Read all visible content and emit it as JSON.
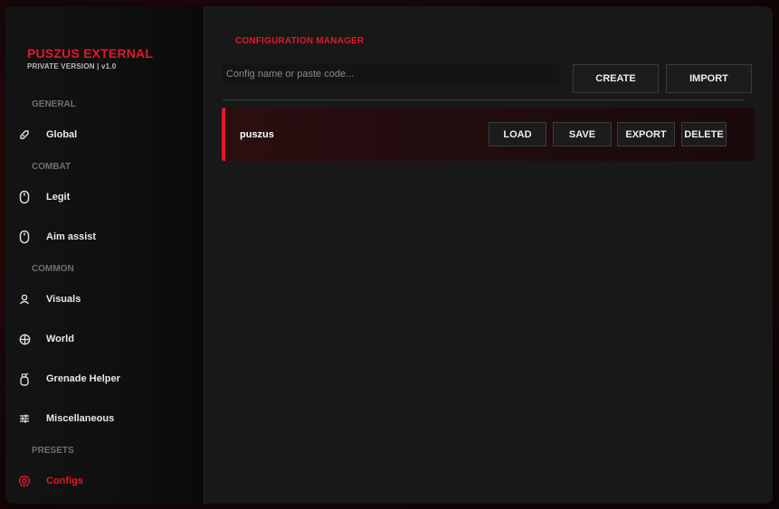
{
  "brand": {
    "title": "PUSZUS EXTERNAL",
    "subtitle": "PRIVATE VERSION | v1.0"
  },
  "sidebar": {
    "sections": [
      {
        "label": "GENERAL"
      },
      {
        "label": "COMBAT"
      },
      {
        "label": "COMMON"
      },
      {
        "label": "PRESETS"
      }
    ],
    "items": [
      {
        "label": "Global",
        "icon": "globe-icon"
      },
      {
        "label": "Legit",
        "icon": "mouse-icon"
      },
      {
        "label": "Aim assist",
        "icon": "mouse-icon"
      },
      {
        "label": "Visuals",
        "icon": "user-icon"
      },
      {
        "label": "World",
        "icon": "crosshair-icon"
      },
      {
        "label": "Grenade Helper",
        "icon": "grenade-icon"
      },
      {
        "label": "Miscellaneous",
        "icon": "sliders-icon"
      },
      {
        "label": "Configs",
        "icon": "gear-icon",
        "active": true
      }
    ]
  },
  "main": {
    "title": "CONFIGURATION MANAGER",
    "input": {
      "value": "",
      "placeholder": "Config name or paste code..."
    },
    "buttons": {
      "create": "CREATE",
      "import": "IMPORT"
    },
    "configs": [
      {
        "name": "puszus",
        "actions": {
          "load": "LOAD",
          "save": "SAVE",
          "export": "EXPORT",
          "delete": "DELETE"
        }
      }
    ]
  },
  "colors": {
    "accent": "#e0192a",
    "panel": "#181818",
    "sidebar": "#111111",
    "card": "#2b0e10"
  }
}
